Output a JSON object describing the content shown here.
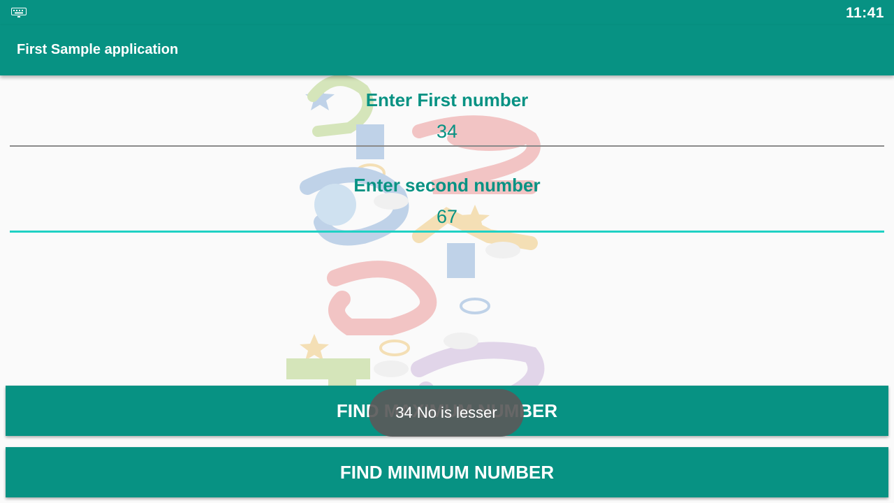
{
  "status_bar": {
    "time": "11:41",
    "icons": [
      "keyboard-icon"
    ]
  },
  "app_bar": {
    "title": "First Sample application"
  },
  "form": {
    "first_label": "Enter First number",
    "first_value": "34",
    "second_label": "Enter second number",
    "second_value": "67"
  },
  "buttons": {
    "find_max": "FIND MAXIMUM NUMBER",
    "find_min": "FIND MINIMUM NUMBER"
  },
  "toast": {
    "message": "34  No is lesser"
  },
  "colors": {
    "primary": "#079283",
    "accent": "#1fd1c4",
    "toast_bg": "#5a5a5a"
  }
}
